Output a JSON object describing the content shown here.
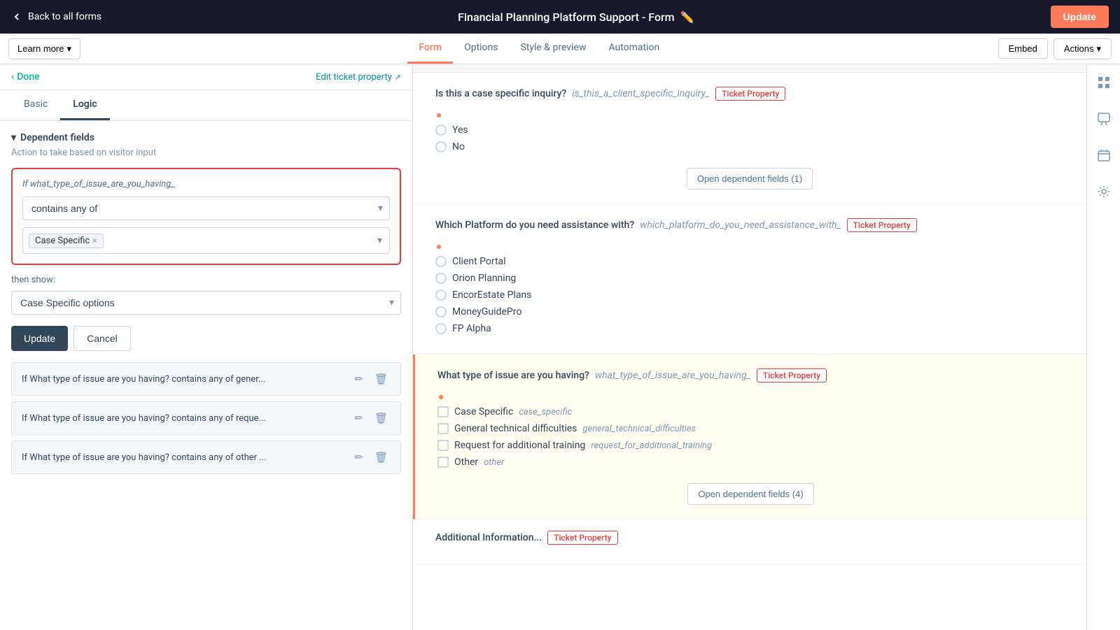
{
  "topNav": {
    "back_label": "Back to all forms",
    "title": "Financial Planning Platform Support - Form",
    "update_label": "Update"
  },
  "tabBar": {
    "learn_more_label": "Learn more",
    "tabs": [
      {
        "id": "form",
        "label": "Form",
        "active": true
      },
      {
        "id": "options",
        "label": "Options",
        "active": false
      },
      {
        "id": "style_preview",
        "label": "Style & preview",
        "active": false
      },
      {
        "id": "automation",
        "label": "Automation",
        "active": false
      }
    ],
    "embed_label": "Embed",
    "actions_label": "Actions"
  },
  "leftPanel": {
    "done_label": "Done",
    "edit_ticket_label": "Edit ticket property",
    "subtabs": [
      {
        "id": "basic",
        "label": "Basic",
        "active": false
      },
      {
        "id": "logic",
        "label": "Logic",
        "active": true
      }
    ],
    "sectionHeader": "Dependent fields",
    "sectionSubtext": "Action to take based on visitor input",
    "condition": {
      "if_label": "If",
      "field_name": "what_type_of_issue_are_you_having_",
      "operator": "contains any of",
      "values": [
        "Case Specific"
      ],
      "then_show_label": "then show:",
      "then_show_value": "Case Specific options"
    },
    "update_label": "Update",
    "cancel_label": "Cancel",
    "condition_rows": [
      {
        "text": "If What type of issue are you having? contains any of gener..."
      },
      {
        "text": "If What type of issue are you having? contains any of reque..."
      },
      {
        "text": "If What type of issue are you having? contains any of other ..."
      }
    ]
  },
  "formPreview": {
    "sections": [
      {
        "id": "case-inquiry",
        "question": "Is this a case specific inquiry?",
        "field_name": "is_this_a_client_specific_inquiry_",
        "badge": "Ticket Property",
        "required": true,
        "type": "radio",
        "options": [
          "Yes",
          "No"
        ],
        "dependent_btn": "Open dependent fields (1)"
      },
      {
        "id": "platform-assistance",
        "question": "Which Platform do you need assistance with?",
        "field_name": "which_platform_do_you_need_assistance_with_",
        "badge": "Ticket Property",
        "required": true,
        "type": "radio",
        "options": [
          "Client Portal",
          "Orion Planning",
          "EncorEstate Plans",
          "MoneyGuidePro",
          "FP Alpha"
        ]
      },
      {
        "id": "issue-type",
        "question": "What type of issue are you having?",
        "field_name": "what_type_of_issue_are_you_having_",
        "badge": "Ticket Property",
        "required": true,
        "highlighted": true,
        "type": "checkbox",
        "options": [
          {
            "label": "Case Specific",
            "value": "case_specific"
          },
          {
            "label": "General technical difficulties",
            "value": "general_technical_difficulties"
          },
          {
            "label": "Request for additional training",
            "value": "request_for_additional_training"
          },
          {
            "label": "Other",
            "value": "other"
          }
        ],
        "dependent_btn": "Open dependent fields (4)"
      }
    ]
  },
  "rightSidebar": {
    "icons": [
      "chat",
      "calendar",
      "settings",
      "calendar2"
    ]
  }
}
